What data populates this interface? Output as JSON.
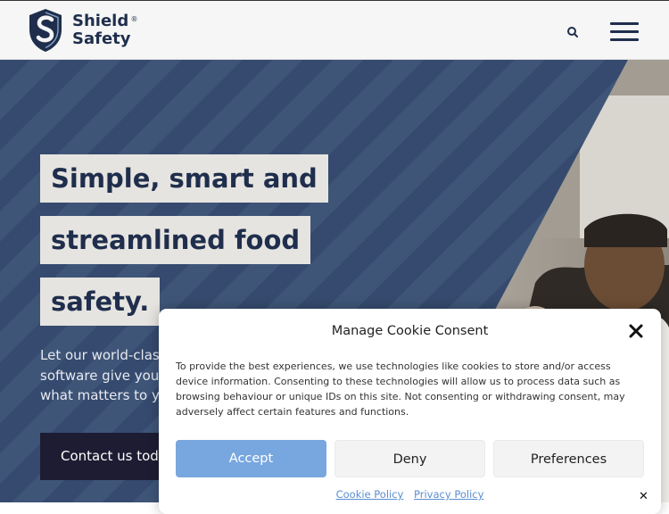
{
  "header": {
    "brand_line1": "Shield",
    "brand_line2": "Safety",
    "trademark": "®",
    "search_icon": "search-icon",
    "menu_icon": "hamburger-menu-icon",
    "brand_color": "#1f2e4c"
  },
  "hero": {
    "headline_lines": [
      "Simple, smart and",
      "streamlined food",
      "safety."
    ],
    "subtext": "Let our world-class\nsoftware give you t\nwhat matters to yo",
    "contact_button": "Contact us tod",
    "stripe_colors": [
      "#354a6e",
      "#3f5578"
    ]
  },
  "cookie_dialog": {
    "title": "Manage Cookie Consent",
    "body": "To provide the best experiences, we use technologies like cookies to store and/or access device information. Consenting to these technologies will allow us to process data such as browsing behaviour or unique IDs on this site. Not consenting or withdrawing consent, may adversely affect certain features and functions.",
    "accept_label": "Accept",
    "deny_label": "Deny",
    "preferences_label": "Preferences",
    "cookie_policy_link": "Cookie Policy",
    "privacy_policy_link": "Privacy Policy",
    "close_icon": "close-icon",
    "accept_color": "#78a7df"
  },
  "small_close_glyph": "✕"
}
